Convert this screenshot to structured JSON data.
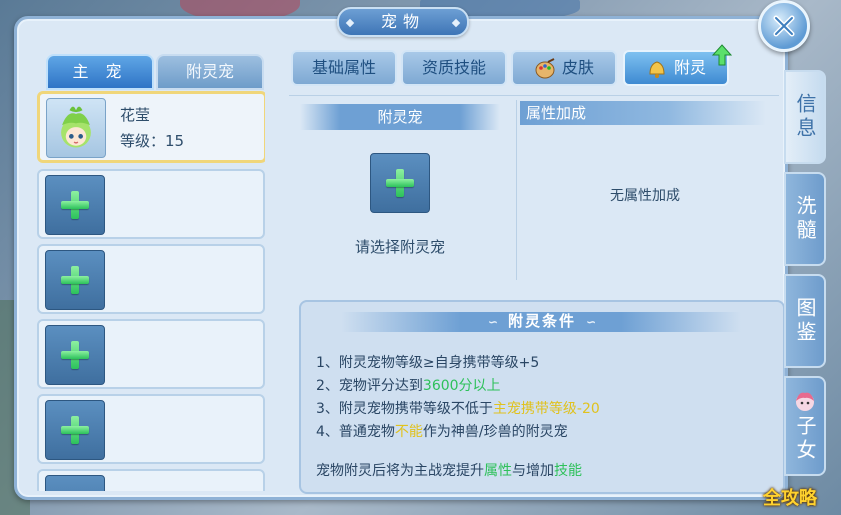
{
  "window": {
    "title": "宠物"
  },
  "left_tabs": [
    {
      "label": "主 宠",
      "active": true
    },
    {
      "label": "附灵宠",
      "active": false
    }
  ],
  "pet_slots": [
    {
      "name": "花莹",
      "level": "等级：15",
      "selected": true
    },
    {
      "empty": true
    },
    {
      "empty": true
    },
    {
      "empty": true
    },
    {
      "empty": true
    },
    {
      "empty": true
    }
  ],
  "top_tabs": [
    {
      "label": "基础属性",
      "icon": ""
    },
    {
      "label": "资质技能",
      "icon": ""
    },
    {
      "label": "皮肤",
      "icon": "palette-icon"
    },
    {
      "label": "附灵",
      "icon": "bell-icon",
      "active": true
    }
  ],
  "spirit": {
    "header": "附灵宠",
    "prompt": "请选择附灵宠"
  },
  "attributes": {
    "header": "属性加成",
    "empty_text": "无属性加成"
  },
  "conditions": {
    "title": "附灵条件",
    "lines": [
      [
        {
          "t": "1、附灵宠物等级≥自身携带等级+5"
        }
      ],
      [
        {
          "t": "2、宠物评分达到"
        },
        {
          "t": "3600分以上",
          "c": "green"
        }
      ],
      [
        {
          "t": "3、附灵宠物携带等级不低于"
        },
        {
          "t": "主宠携带等级",
          "c": "yellow"
        },
        {
          "t": "-20",
          "c": "yellow"
        }
      ],
      [
        {
          "t": "4、普通宠物"
        },
        {
          "t": "不能",
          "c": "yellow"
        },
        {
          "t": "作为神兽/珍兽的附灵宠"
        }
      ]
    ],
    "footer": [
      {
        "t": "宠物附灵后将为主战宠提升"
      },
      {
        "t": "属性",
        "c": "green"
      },
      {
        "t": "与增加"
      },
      {
        "t": "技能",
        "c": "green"
      }
    ]
  },
  "side_tabs": [
    {
      "label": "信息",
      "active": true
    },
    {
      "label": "洗髓",
      "active": false
    },
    {
      "label": "图鉴",
      "active": false
    },
    {
      "label": "子女",
      "active": false,
      "icon": "girl-icon"
    }
  ],
  "watermark": "全攻略",
  "colors": {
    "green_highlight": "#2ec15a",
    "yellow_highlight": "#e0c21e",
    "accent": "#3e8ad2"
  }
}
